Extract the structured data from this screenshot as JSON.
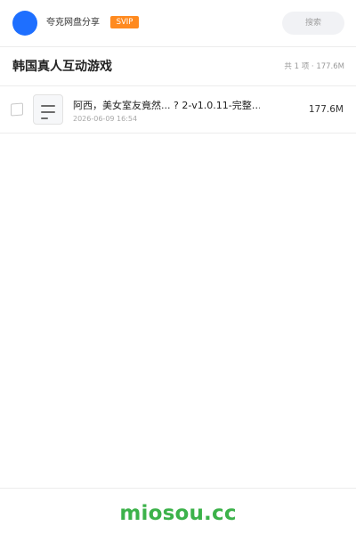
{
  "header": {
    "user_name": "夸克网盘分享",
    "badge": "SVIP",
    "search_placeholder": "搜索"
  },
  "title_bar": {
    "title": "韩国真人互动游戏",
    "summary": "共 1 项 · 177.6M"
  },
  "files": [
    {
      "name": "阿西，美女室友竟然... ? 2-v1.0.11-完整…",
      "date": "2026-06-09 16:54",
      "size": "177.6M",
      "icon": "document-icon"
    }
  ],
  "footer": {
    "watermark": "miosou.cc"
  },
  "colors": {
    "accent": "#1e6fff",
    "svip": "#ff8a1f",
    "watermark": "#3cb24a"
  }
}
